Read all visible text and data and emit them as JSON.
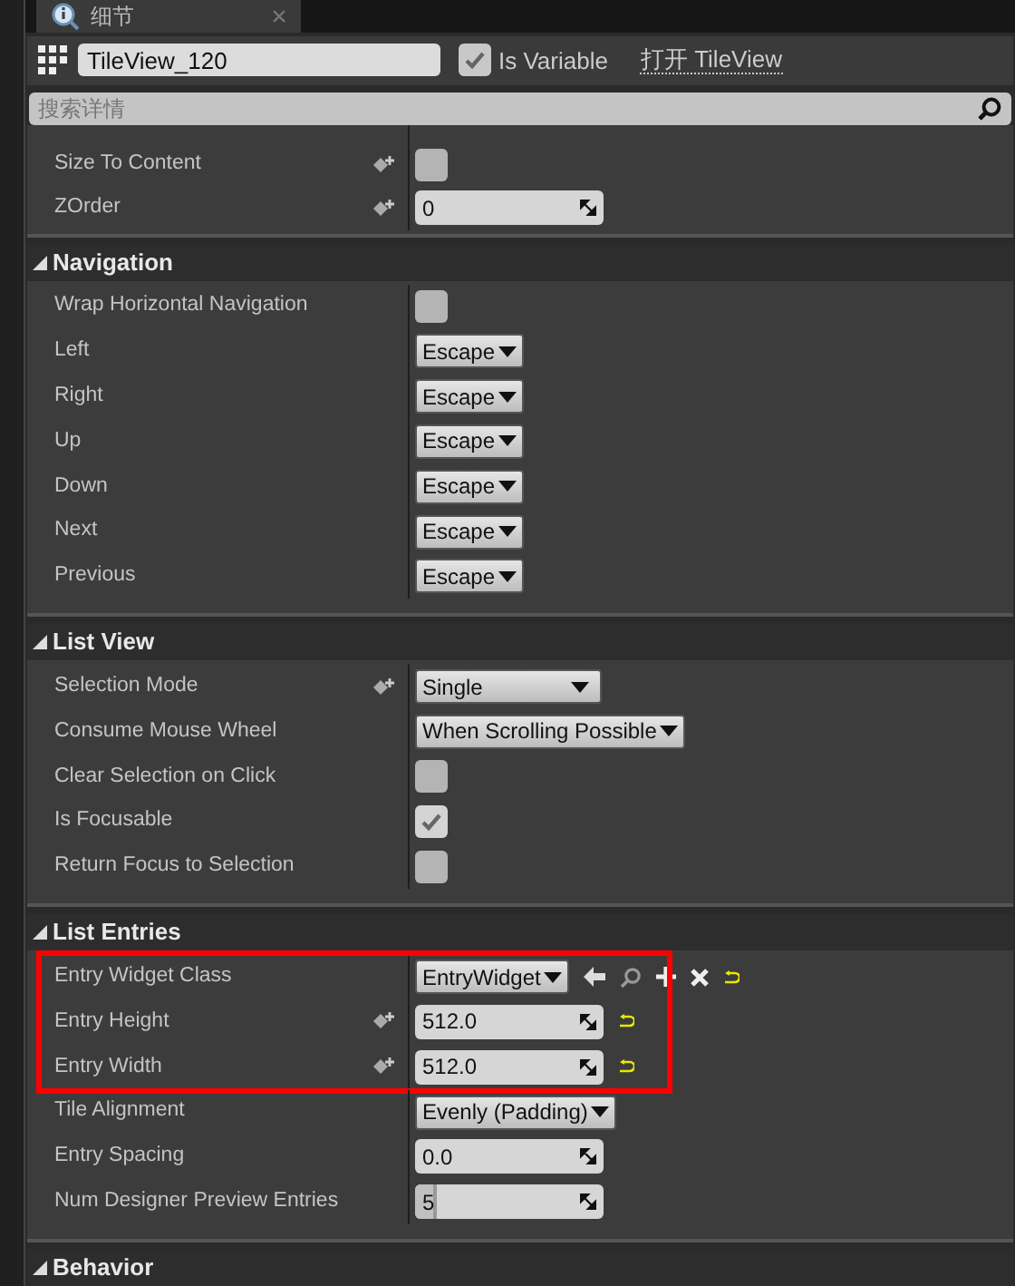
{
  "tab": {
    "title": "细节"
  },
  "header": {
    "name": "TileView_120",
    "is_variable": {
      "label": "Is Variable",
      "checked": true
    },
    "open_link": "打开 TileView"
  },
  "search": {
    "placeholder": "搜索详情"
  },
  "top_rows": [
    {
      "label": "Size To Content",
      "kind": "checkbox",
      "checked": false,
      "bindable": true
    },
    {
      "label": "ZOrder",
      "kind": "number",
      "value": "0",
      "bindable": true
    }
  ],
  "sections": [
    {
      "title": "Navigation",
      "expanded": true,
      "rows": [
        {
          "label": "Wrap Horizontal Navigation",
          "kind": "checkbox",
          "checked": false
        },
        {
          "label": "Left",
          "kind": "dropdown",
          "value": "Escape"
        },
        {
          "label": "Right",
          "kind": "dropdown",
          "value": "Escape"
        },
        {
          "label": "Up",
          "kind": "dropdown",
          "value": "Escape"
        },
        {
          "label": "Down",
          "kind": "dropdown",
          "value": "Escape"
        },
        {
          "label": "Next",
          "kind": "dropdown",
          "value": "Escape"
        },
        {
          "label": "Previous",
          "kind": "dropdown",
          "value": "Escape"
        }
      ]
    },
    {
      "title": "List View",
      "expanded": true,
      "rows": [
        {
          "label": "Selection Mode",
          "kind": "dropdown",
          "value": "Single",
          "bindable": true,
          "wide": true
        },
        {
          "label": "Consume Mouse Wheel",
          "kind": "dropdown",
          "value": "When Scrolling Possible"
        },
        {
          "label": "Clear Selection on Click",
          "kind": "checkbox",
          "checked": false
        },
        {
          "label": "Is Focusable",
          "kind": "checkbox",
          "checked": true
        },
        {
          "label": "Return Focus to Selection",
          "kind": "checkbox",
          "checked": false
        }
      ]
    },
    {
      "title": "List Entries",
      "expanded": true,
      "rows": [
        {
          "label": "Entry Widget Class",
          "kind": "class",
          "value": "EntryWidget",
          "highlighted": true,
          "reset": true
        },
        {
          "label": "Entry Height",
          "kind": "number",
          "value": "512.0",
          "bindable": true,
          "highlighted": true,
          "reset": true
        },
        {
          "label": "Entry Width",
          "kind": "number",
          "value": "512.0",
          "bindable": true,
          "highlighted": true,
          "reset": true
        },
        {
          "label": "Tile Alignment",
          "kind": "dropdown",
          "value": "Evenly (Padding)"
        },
        {
          "label": "Entry Spacing",
          "kind": "number",
          "value": "0.0"
        },
        {
          "label": "Num Designer Preview Entries",
          "kind": "slider",
          "value": "5",
          "level": 0.12
        }
      ]
    },
    {
      "title": "Behavior",
      "expanded": true
    }
  ]
}
